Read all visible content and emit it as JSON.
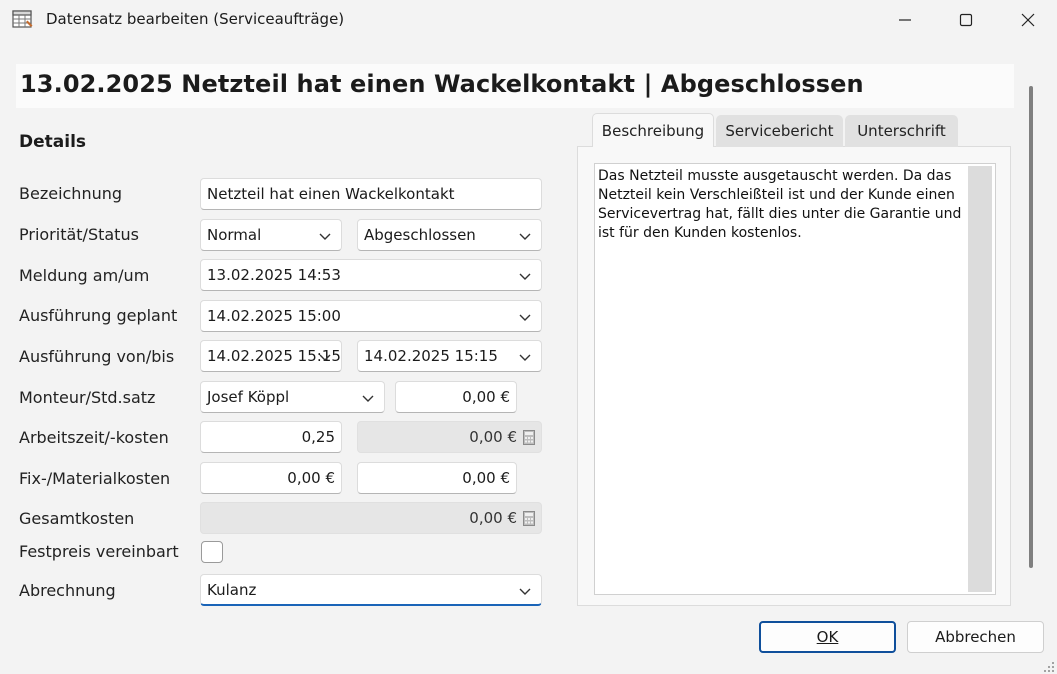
{
  "window": {
    "title": "Datensatz bearbeiten (Serviceaufträge)"
  },
  "header": {
    "title": "13.02.2025 Netzteil hat einen Wackelkontakt | Abgeschlossen"
  },
  "details": {
    "section_title": "Details",
    "labels": {
      "bezeichnung": "Bezeichnung",
      "prioritaet_status": "Priorität/Status",
      "meldung": "Meldung am/um",
      "ausfuehrung_geplant": "Ausführung geplant",
      "ausfuehrung_von_bis": "Ausführung von/bis",
      "monteur": "Monteur/Std.satz",
      "arbeitszeit": "Arbeitszeit/-kosten",
      "fix_material": "Fix-/Materialkosten",
      "gesamtkosten": "Gesamtkosten",
      "festpreis": "Festpreis vereinbart",
      "abrechnung": "Abrechnung"
    },
    "values": {
      "bezeichnung": "Netzteil hat einen Wackelkontakt",
      "prioritaet": "Normal",
      "status": "Abgeschlossen",
      "meldung": "13.02.2025 14:53",
      "ausfuehrung_geplant": "14.02.2025 15:00",
      "ausfuehrung_von": "14.02.2025 15:15",
      "ausfuehrung_bis": "14.02.2025 15:15",
      "monteur": "Josef Köppl",
      "stundensatz": "0,00 €",
      "arbeitszeit": "0,25",
      "arbeitskosten": "0,00 €",
      "fixkosten": "0,00 €",
      "materialkosten": "0,00 €",
      "gesamtkosten": "0,00 €",
      "festpreis_checked": false,
      "abrechnung": "Kulanz"
    }
  },
  "tabs": [
    {
      "label": "Beschreibung",
      "active": true
    },
    {
      "label": "Servicebericht",
      "active": false
    },
    {
      "label": "Unterschrift",
      "active": false
    }
  ],
  "description": {
    "text": "Das Netzteil musste ausgetauscht werden. Da das Netzteil kein Verschleißteil ist und der Kunde einen Servicevertrag hat, fällt dies unter die Garantie und ist für den Kunden kostenlos."
  },
  "buttons": {
    "ok_label": "OK",
    "cancel_label": "Abbrechen"
  },
  "colors": {
    "accent": "#0f4f9b",
    "focus_underline": "#1a64b8"
  },
  "icons": [
    "table-grid-icon",
    "minimize-icon",
    "maximize-icon",
    "close-icon",
    "chevron-down-icon",
    "calculator-icon",
    "resize-grip-icon"
  ]
}
